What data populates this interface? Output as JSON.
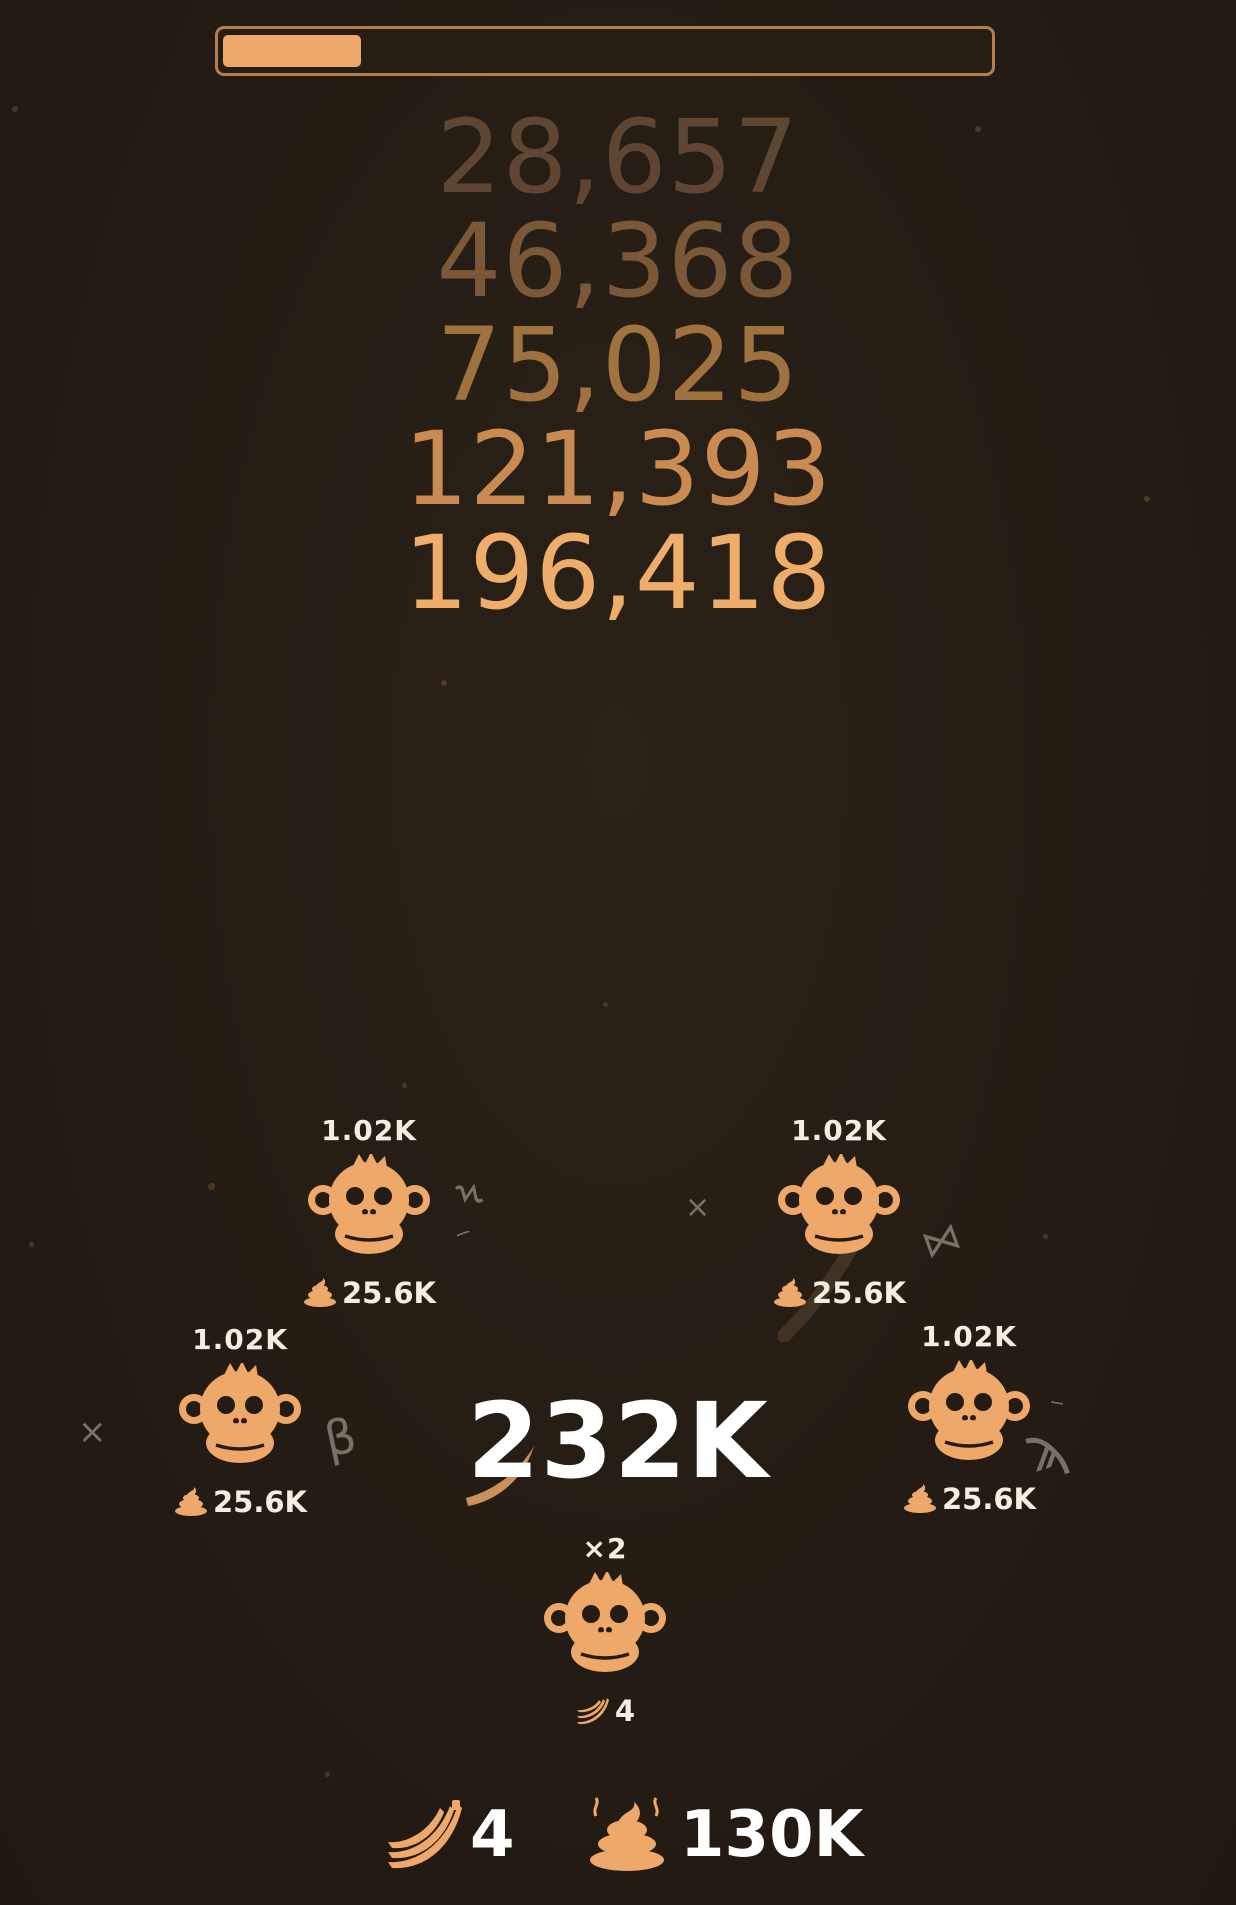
{
  "progress": {
    "fraction": 0.18
  },
  "sequence": [
    "28,657",
    "46,368",
    "75,025",
    "121,393",
    "196,418"
  ],
  "sequence_colors": [
    "#5f4632",
    "#7b5838",
    "#a0723f",
    "#c98b52",
    "#efad6c"
  ],
  "monkeys": [
    {
      "id": "monkey-top-left",
      "top_label": "1.02K",
      "bottom_icon": "poop-icon",
      "bottom_value": "25.6K"
    },
    {
      "id": "monkey-top-right",
      "top_label": "1.02K",
      "bottom_icon": "poop-icon",
      "bottom_value": "25.6K"
    },
    {
      "id": "monkey-mid-left",
      "top_label": "1.02K",
      "bottom_icon": "poop-icon",
      "bottom_value": "25.6K"
    },
    {
      "id": "monkey-mid-right",
      "top_label": "1.02K",
      "bottom_icon": "poop-icon",
      "bottom_value": "25.6K"
    },
    {
      "id": "monkey-bottom",
      "top_label": "×2",
      "bottom_icon": "banana-icon",
      "bottom_value": "4"
    }
  ],
  "center_total": "232K",
  "floating_glyphs": [
    "×",
    "β",
    "ϡ",
    "×",
    "⋈",
    "Ϟ",
    "‒",
    "‒"
  ],
  "footer": {
    "bananas": "4",
    "poop": "130K"
  },
  "colors": {
    "accent": "#eea86a",
    "background": "#251d15",
    "text": "#ffffff"
  }
}
